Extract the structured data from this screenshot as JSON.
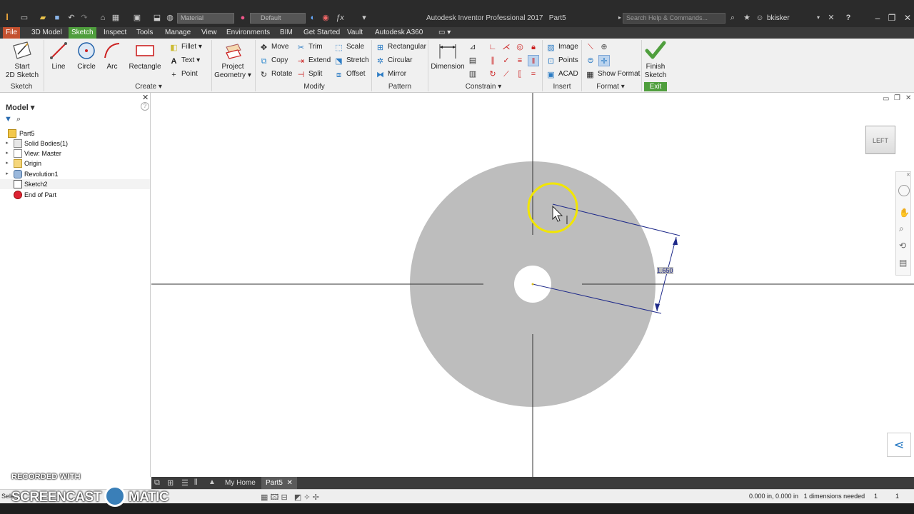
{
  "titlebar": {
    "app_title": "Autodesk Inventor Professional 2017",
    "doc_name": "Part5",
    "search_placeholder": "Search Help & Commands...",
    "username": "bkisker",
    "material_value": "Material",
    "appearance_value": "Default"
  },
  "menu": {
    "tabs": [
      "File",
      "3D Model",
      "Sketch",
      "Inspect",
      "Tools",
      "Manage",
      "View",
      "Environments",
      "BIM",
      "Get Started",
      "Vault",
      "Autodesk A360"
    ],
    "active": "Sketch"
  },
  "ribbon": {
    "sketch": {
      "start": "Start",
      "start2": "2D Sketch",
      "label": "Sketch"
    },
    "create": {
      "line": "Line",
      "circle": "Circle",
      "arc": "Arc",
      "rectangle": "Rectangle",
      "fillet": "Fillet",
      "text": "Text",
      "point": "Point",
      "label": "Create"
    },
    "project": {
      "l1": "Project",
      "l2": "Geometry"
    },
    "modify": {
      "move": "Move",
      "copy": "Copy",
      "rotate": "Rotate",
      "trim": "Trim",
      "extend": "Extend",
      "split": "Split",
      "scale": "Scale",
      "stretch": "Stretch",
      "offset": "Offset",
      "label": "Modify"
    },
    "pattern": {
      "rectangular": "Rectangular",
      "circular": "Circular",
      "mirror": "Mirror",
      "label": "Pattern"
    },
    "constrain": {
      "dimension": "Dimension",
      "label": "Constrain"
    },
    "insert": {
      "image": "Image",
      "points": "Points",
      "acad": "ACAD",
      "label": "Insert"
    },
    "format": {
      "show_format": "Show Format",
      "label": "Format"
    },
    "exit": {
      "l1": "Finish",
      "l2": "Sketch",
      "label": "Exit"
    }
  },
  "browser": {
    "title": "Model",
    "items": [
      {
        "label": "Part5",
        "icon": "part-icon"
      },
      {
        "label": "Solid Bodies(1)",
        "icon": "solid-bodies-icon"
      },
      {
        "label": "View: Master",
        "icon": "view-icon"
      },
      {
        "label": "Origin",
        "icon": "folder-icon"
      },
      {
        "label": "Revolution1",
        "icon": "revolve-icon"
      },
      {
        "label": "Sketch2",
        "icon": "sketch-icon"
      },
      {
        "label": "End of Part",
        "icon": "end-of-part-icon"
      }
    ]
  },
  "canvas": {
    "viewcube_label": "LEFT",
    "dimension_value": "1.650"
  },
  "tabs": {
    "home": "My Home",
    "doc": "Part5"
  },
  "status": {
    "left": "Sele",
    "coords": "0.000 in, 0.000 in",
    "message": "1 dimensions needed",
    "n1": "1",
    "n2": "1"
  },
  "watermark": {
    "top": "RECORDED WITH",
    "left": "SCREENCAST",
    "right": "MATIC"
  },
  "colors": {
    "accent_green": "#4f9e3d",
    "file_tab": "#c4512f",
    "part_gray": "#bdbdbd",
    "dimension_blue": "#1f2a8a",
    "highlight_yellow": "#f2e600"
  }
}
